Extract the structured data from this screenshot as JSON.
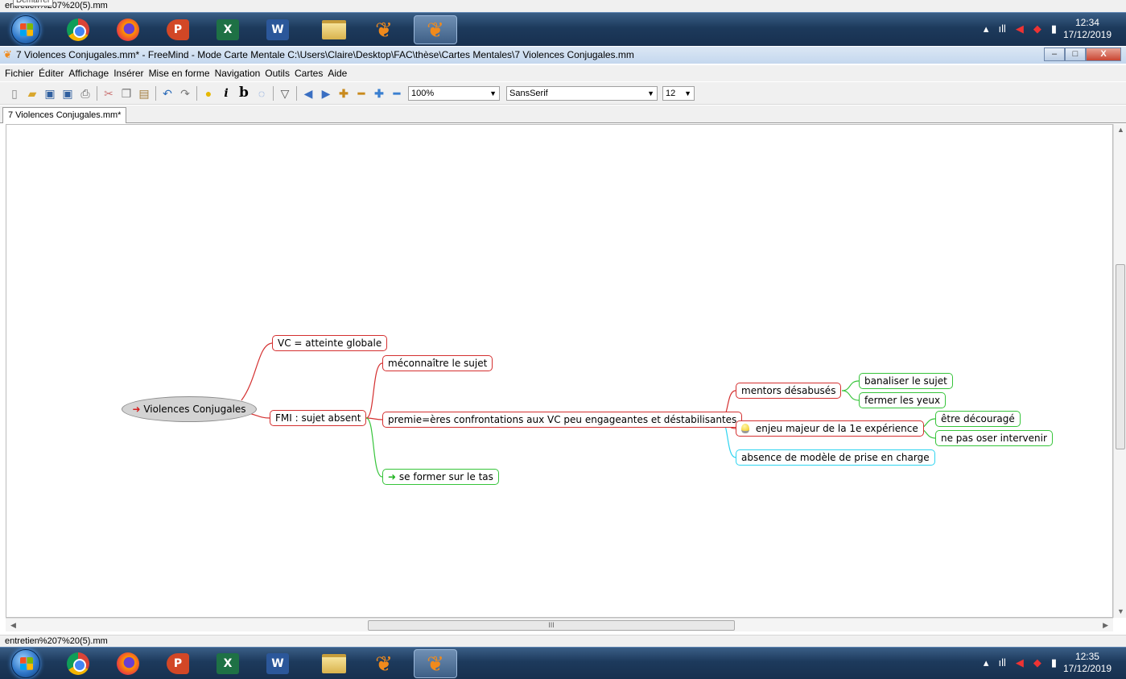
{
  "top_strip": {
    "text": "entretien%207%20(5).mm",
    "tooltip": "Démarrer"
  },
  "bottom_strip": {
    "text": "entretien%207%20(5).mm"
  },
  "taskbar_top": {
    "clock_time": "12:34",
    "clock_date": "17/12/2019"
  },
  "taskbar_bottom": {
    "clock_time": "12:35",
    "clock_date": "17/12/2019"
  },
  "taskbar_apps": [
    "chrome-icon",
    "firefox-icon",
    "powerpoint-icon",
    "excel-icon",
    "word-icon",
    "file-explorer-icon",
    "freemind-icon",
    "freemind-icon"
  ],
  "window": {
    "title": "7 Violences Conjugales.mm* - FreeMind - Mode Carte Mentale C:\\Users\\Claire\\Desktop\\FAC\\thèse\\Cartes Mentales\\7 Violences Conjugales.mm",
    "minimize": "–",
    "maximize": "□",
    "close": "X"
  },
  "menu": [
    "Fichier",
    "Éditer",
    "Affichage",
    "Insérer",
    "Mise en forme",
    "Navigation",
    "Outils",
    "Cartes",
    "Aide"
  ],
  "toolbar": {
    "zoom": "100%",
    "font": "SansSerif",
    "font_size": "12"
  },
  "tab": {
    "label": "7 Violences Conjugales.mm*"
  },
  "scrollbar": {
    "grip": "III"
  },
  "mindmap": {
    "root": "Violences Conjugales",
    "vc_atteinte": "VC = atteinte globale",
    "fmi_sujet_absent": "FMI : sujet absent",
    "meconnaitre": "méconnaître le sujet",
    "premieres": "premie=ères confrontations aux VC peu engageantes et déstabilisantes",
    "se_former": "se former sur le tas",
    "mentors": "mentors désabusés",
    "banaliser": "banaliser le sujet",
    "fermer": "fermer les yeux",
    "enjeu": "enjeu majeur de la 1e expérience",
    "etre_decourage": "être découragé",
    "ne_pas_oser": "ne pas oser intervenir",
    "absence": "absence de modèle de prise en charge"
  },
  "colors": {
    "red_edge": "#d43030",
    "green_edge": "#36c43a",
    "cyan_edge": "#2fd4f0",
    "root_fill": "#d3d3d3"
  }
}
